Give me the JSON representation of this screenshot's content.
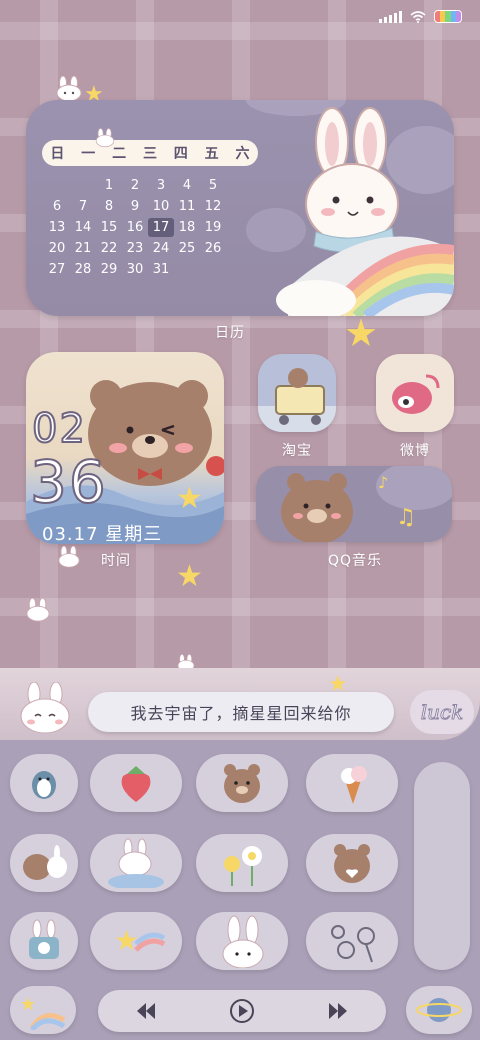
{
  "status_bar": {
    "signal": "signal-icon",
    "wifi": "wifi-icon",
    "battery": "battery-icon"
  },
  "calendar": {
    "label": "日历",
    "weekdays": [
      "日",
      "一",
      "二",
      "三",
      "四",
      "五",
      "六"
    ],
    "days": [
      "",
      "",
      "1",
      "2",
      "3",
      "4",
      "5",
      "6",
      "7",
      "8",
      "9",
      "10",
      "11",
      "12",
      "13",
      "14",
      "15",
      "16",
      "17",
      "18",
      "19",
      "20",
      "21",
      "22",
      "23",
      "24",
      "25",
      "26",
      "27",
      "28",
      "29",
      "30",
      "31"
    ],
    "today": "17"
  },
  "clock": {
    "hour": "02",
    "minute": "36",
    "date": "03.17  星期三",
    "label": "时间"
  },
  "apps": {
    "taobao": "淘宝",
    "weibo": "微博",
    "qq_music": "QQ音乐"
  },
  "dock": {
    "message": "我去宇宙了，摘星星回来给你",
    "luck_text": "luck"
  },
  "player": {
    "prev": "previous-icon",
    "play": "play-icon",
    "next": "next-icon"
  },
  "colors": {
    "background": "#b79aa8",
    "widget": "#958ba7",
    "accent": "#f7d766"
  }
}
